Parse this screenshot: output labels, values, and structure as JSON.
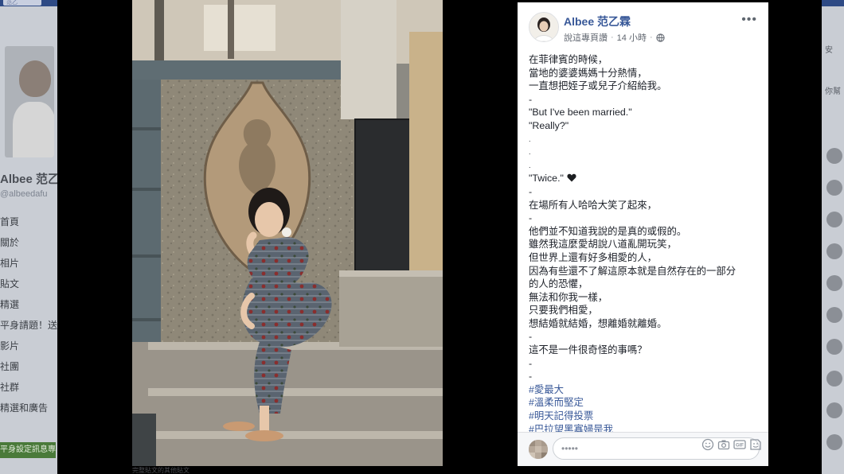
{
  "background": {
    "search_text": "范乙",
    "page_name": "Albee 范乙",
    "page_handle": "@albeedafu",
    "menu": [
      "首頁",
      "關於",
      "相片",
      "貼文",
      "精選",
      "平身請題！送",
      "影片",
      "社團",
      "社群",
      "精選和廣告"
    ],
    "cta_label": "平身設定訊息專頁",
    "right_labels": [
      "安",
      "你幫"
    ]
  },
  "photo": {
    "caption": "完整貼文的其他貼文"
  },
  "post": {
    "author": "Albee 范乙霖",
    "source": "說這專頁讚",
    "time": "14 小時",
    "separator": "·",
    "more_label": "•••",
    "lines": [
      "在菲律賓的時候，",
      "當地的婆婆媽媽十分熱情，",
      "一直想把姪子或兒子介紹給我。",
      "-",
      "\"But I've been married.\"",
      "\"Really?\"",
      ".",
      ".",
      ".",
      "\"Twice.\"",
      "-",
      "在場所有人哈哈大笑了起來，",
      "-",
      "他們並不知道我說的是真的或假的。",
      "雖然我這麼愛胡說八道亂開玩笑，",
      "但世界上還有好多相愛的人，",
      "因為有些還不了解這原本就是自然存在的一部分",
      "的人的恐懼，",
      "無法和你我一樣，",
      "只要我們相愛，",
      "想結婚就結婚，想離婚就離婚。",
      "-",
      "這不是一件很奇怪的事嗎？",
      "-",
      "-"
    ],
    "hashtags": [
      "#愛最大",
      "#溫柔而堅定",
      "#明天記得投票",
      "#巴拉望黑寡婦是我"
    ]
  },
  "comment": {
    "placeholder": "•••••"
  },
  "icons": {
    "heart": "black-heart-icon",
    "globe": "globe-icon",
    "emoji": "emoji-icon",
    "camera": "camera-icon",
    "gif": "gif-icon",
    "sticker": "sticker-icon"
  },
  "colors": {
    "link": "#385898",
    "topbar": "#2e4a85",
    "lightbox": "#000000"
  }
}
